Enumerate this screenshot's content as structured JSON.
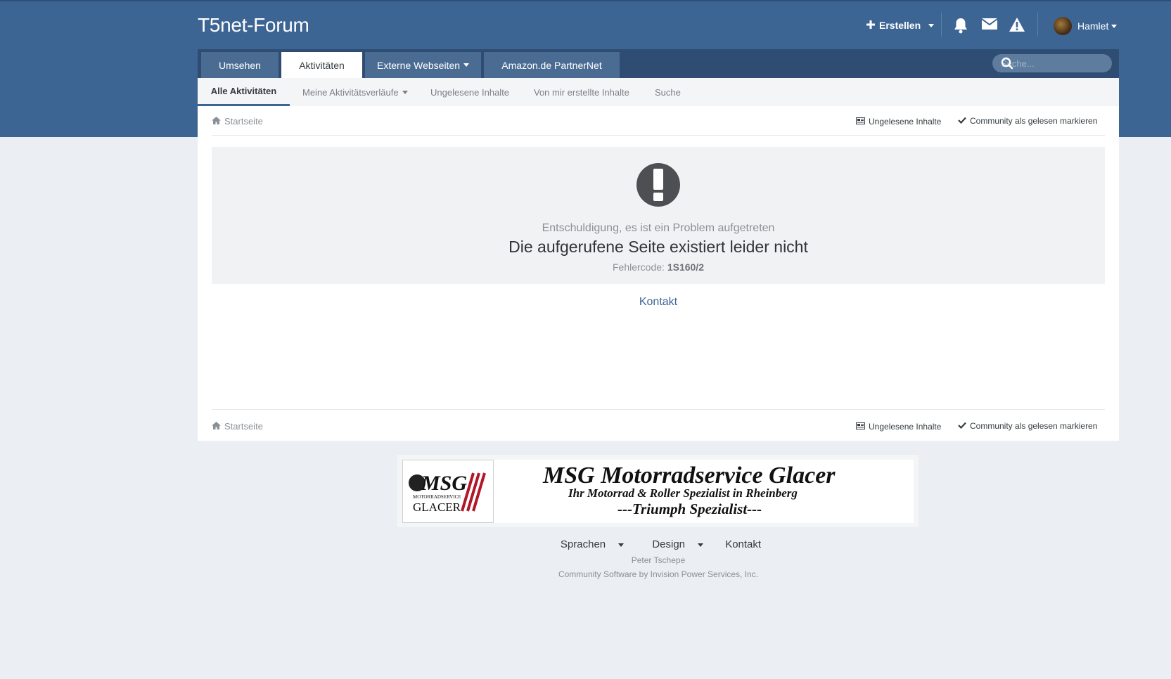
{
  "header": {
    "site_title": "T5net-Forum",
    "create_label": "Erstellen",
    "username": "Hamlet"
  },
  "nav": {
    "tabs": [
      {
        "label": "Umsehen"
      },
      {
        "label": "Aktivitäten"
      },
      {
        "label": "Externe Webseiten"
      },
      {
        "label": "Amazon.de PartnerNet"
      }
    ],
    "search_placeholder": "Suche..."
  },
  "subnav": {
    "items": [
      {
        "label": "Alle Aktivitäten"
      },
      {
        "label": "Meine Aktivitätsverläufe"
      },
      {
        "label": "Ungelesene Inhalte"
      },
      {
        "label": "Von mir erstellte Inhalte"
      },
      {
        "label": "Suche"
      }
    ]
  },
  "breadcrumb": {
    "home": "Startseite",
    "unread": "Ungelesene Inhalte",
    "mark_read": "Community als gelesen markieren"
  },
  "error": {
    "subtitle": "Entschuldigung, es ist ein Problem aufgetreten",
    "message": "Die aufgerufene Seite existiert leider nicht",
    "code_label": "Fehlercode:",
    "code": "1S160/2",
    "contact": "Kontakt"
  },
  "ad": {
    "logo_text": "MSG",
    "logo_sub": "MOTORRADSERVICE",
    "logo_name": "GLACER",
    "title": "MSG Motorradservice Glacer",
    "subtitle": "Ihr Motorrad & Roller Spezialist in Rheinberg",
    "tagline": "---Triumph Spezialist---"
  },
  "footer": {
    "languages": "Sprachen",
    "design": "Design",
    "contact": "Kontakt",
    "owner": "Peter Tschepe",
    "software": "Community Software by Invision Power Services, Inc."
  }
}
